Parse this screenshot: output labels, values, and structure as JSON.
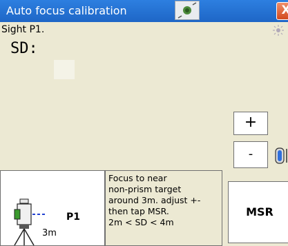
{
  "window": {
    "title": "Auto focus calibration",
    "close_label": "X"
  },
  "main": {
    "prompt": "Sight P1.",
    "sd_label": "SD:",
    "buttons": {
      "plus": "+",
      "minus": "-",
      "msr": "MSR"
    },
    "diagram": {
      "target_label": "P1",
      "distance_label": "3m"
    },
    "help_lines": [
      "Focus to near",
      "non-prism target",
      "around 3m. adjust +-",
      "then tap MSR.",
      "2m < SD < 4m"
    ]
  },
  "icons": {
    "title_icon": "target-icon",
    "sun": "sun-icon",
    "prism": "prism-icon",
    "instrument": "total-station-icon"
  }
}
